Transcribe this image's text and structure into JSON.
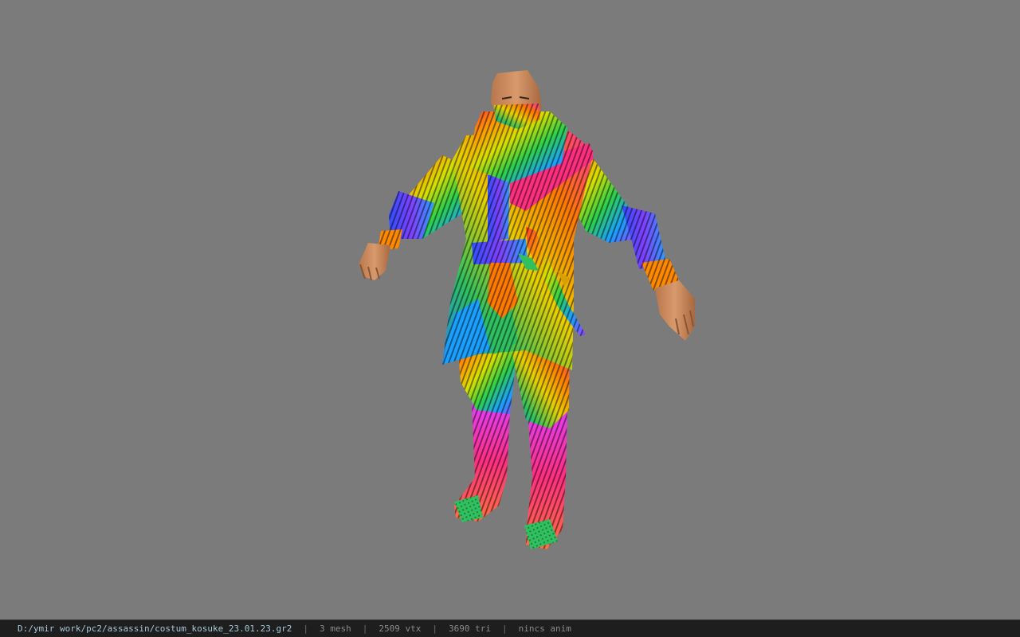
{
  "viewport": {
    "background_color": "#7b7b7b",
    "model_description_icon": "character-model"
  },
  "statusbar": {
    "file_path": "D:/ymir work/pc2/assassin/costum_kosuke_23.01.23.gr2",
    "separator": "|",
    "mesh_count": "3 mesh",
    "vertex_count": "2509 vtx",
    "triangle_count": "3690 tri",
    "anim_status": "nincs anim"
  },
  "colors": {
    "skin": "#c98a5e",
    "skin_shadow": "#8a5535",
    "status_bg": "#1e1e1e",
    "path_text": "#a8c8d8",
    "status_text": "#8a8a8a"
  }
}
